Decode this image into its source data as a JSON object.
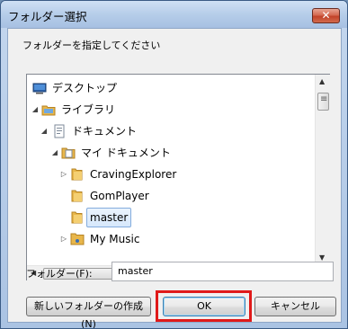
{
  "window": {
    "title": "フォルダー選択",
    "close_glyph": "✕"
  },
  "instruction": "フォルダーを指定してください",
  "tree": {
    "items": [
      {
        "label": "デスクトップ",
        "icon": "desktop-icon",
        "expander": ""
      },
      {
        "label": "ライブラリ",
        "icon": "library-folder-icon",
        "expander": "◢"
      },
      {
        "label": "ドキュメント",
        "icon": "document-library-icon",
        "expander": "◢"
      },
      {
        "label": "マイ ドキュメント",
        "icon": "document-folder-icon",
        "expander": "◢"
      },
      {
        "label": "CravingExplorer",
        "icon": "folder-icon",
        "expander": "▷"
      },
      {
        "label": "GomPlayer",
        "icon": "folder-icon",
        "expander": ""
      },
      {
        "label": "master",
        "icon": "folder-icon",
        "expander": "",
        "selected": true
      },
      {
        "label": "My Music",
        "icon": "music-folder-icon",
        "expander": "▷"
      }
    ]
  },
  "folder_field": {
    "label": "フォルダー(F):",
    "value": "master"
  },
  "buttons": {
    "new_folder": "新しいフォルダーの作成(N)",
    "ok": "OK",
    "cancel": "キャンセル"
  },
  "colors": {
    "highlight": "#e01a1a",
    "folder": "#e8b64a"
  }
}
